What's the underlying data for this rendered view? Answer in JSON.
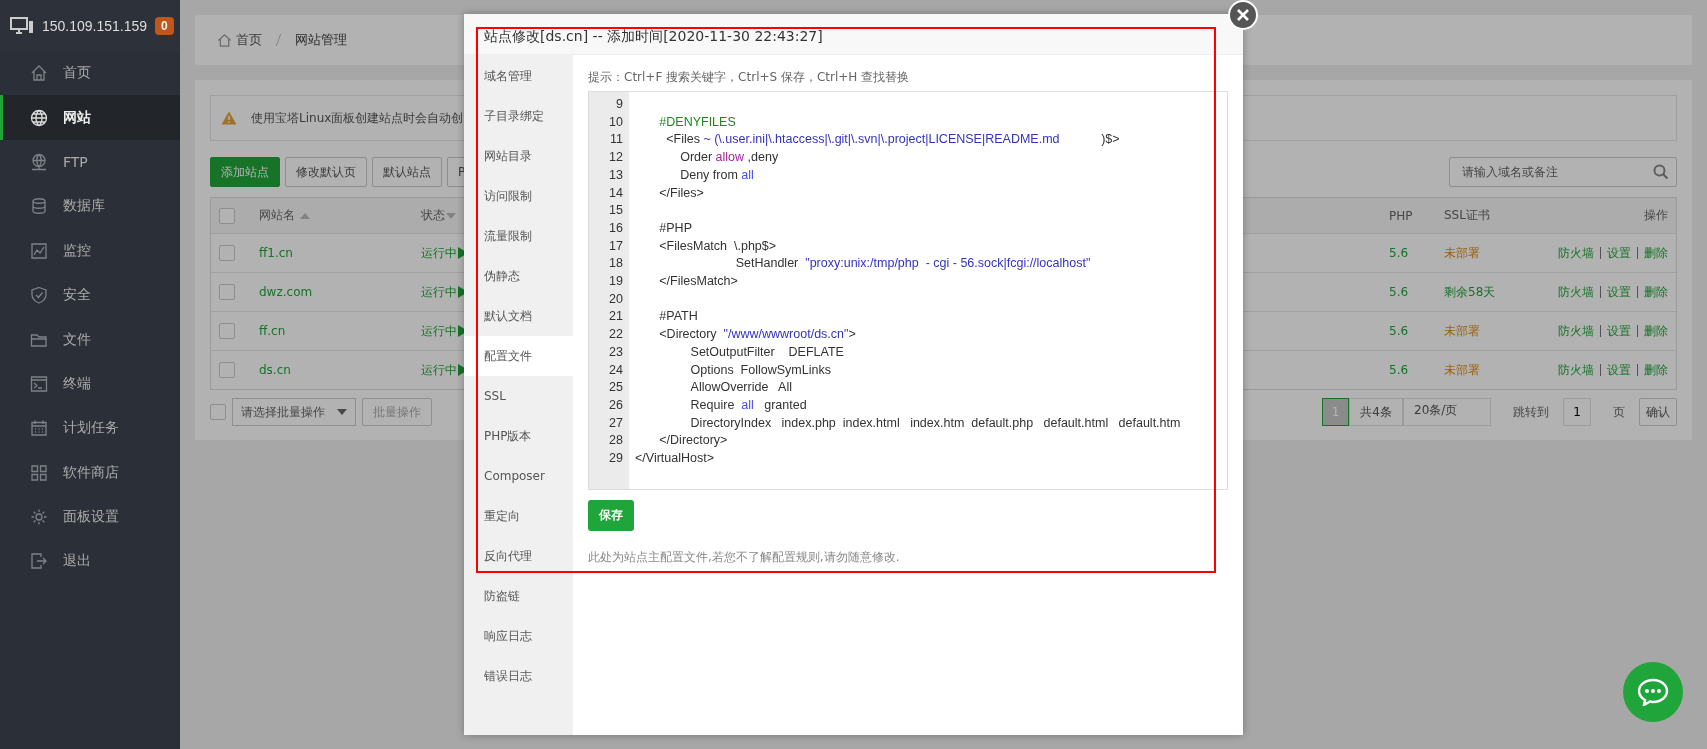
{
  "sidebar": {
    "server": "150.109.151.159",
    "badge": "0",
    "items": [
      {
        "label": "首页",
        "selected": false
      },
      {
        "label": "网站",
        "selected": true
      },
      {
        "label": "FTP",
        "selected": false
      },
      {
        "label": "数据库",
        "selected": false
      },
      {
        "label": "监控",
        "selected": false
      },
      {
        "label": "安全",
        "selected": false
      },
      {
        "label": "文件",
        "selected": false
      },
      {
        "label": "终端",
        "selected": false
      },
      {
        "label": "计划任务",
        "selected": false
      },
      {
        "label": "软件商店",
        "selected": false
      },
      {
        "label": "面板设置",
        "selected": false
      },
      {
        "label": "退出",
        "selected": false
      }
    ]
  },
  "breadcrumb": [
    "首页",
    "网站管理"
  ],
  "notice": "使用宝塔Linux面板创建站点时会自动创",
  "toolbar": {
    "buttons": [
      {
        "label": "添加站点",
        "primary": true
      },
      {
        "label": "修改默认页",
        "primary": false
      },
      {
        "label": "默认站点",
        "primary": false
      },
      {
        "label": "P",
        "primary": false
      }
    ],
    "search": {
      "placeholder": "请输入域名或备注"
    }
  },
  "table": {
    "columns": [
      {
        "label": "网站名",
        "kind": "sort-up"
      },
      {
        "label": "状态",
        "kind": "sort-down"
      },
      {
        "label": "PHP",
        "kind": "plain"
      },
      {
        "label": "SSL证书",
        "kind": "plain"
      },
      {
        "label": "操作",
        "kind": "plain"
      }
    ],
    "all_checked": false,
    "rows": [
      {
        "checked": false,
        "name": "ff1.cn",
        "status": "运行中",
        "php": "5.6",
        "ssl": "未部署",
        "deployed": false,
        "actions": [
          "防火墙",
          "设置",
          "删除"
        ]
      },
      {
        "checked": false,
        "name": "dwz.com",
        "status": "运行中",
        "php": "5.6",
        "ssl": "剩余58天",
        "deployed": true,
        "actions": [
          "防火墙",
          "设置",
          "删除"
        ]
      },
      {
        "checked": false,
        "name": "ff.cn",
        "status": "运行中",
        "php": "5.6",
        "ssl": "未部署",
        "deployed": false,
        "actions": [
          "防火墙",
          "设置",
          "删除"
        ]
      },
      {
        "checked": false,
        "name": "ds.cn",
        "status": "运行中",
        "php": "5.6",
        "ssl": "未部署",
        "deployed": false,
        "actions": [
          "防火墙",
          "设置",
          "删除"
        ]
      }
    ]
  },
  "footer": {
    "checked": false,
    "batch_select": "请选择批量操作",
    "batch_button": "批量操作",
    "pages": [
      {
        "label": "1",
        "selected": true
      }
    ],
    "total": "共4条",
    "page_size": "20条/页",
    "jump_label": "跳转到",
    "jump_value": "1",
    "page_unit": "页",
    "confirm": "确认"
  },
  "modal": {
    "title": "站点修改[ds.cn] -- 添加时间[2020-11-30 22:43:27]",
    "tabs": [
      {
        "label": "域名管理",
        "selected": false
      },
      {
        "label": "子目录绑定",
        "selected": false
      },
      {
        "label": "网站目录",
        "selected": false
      },
      {
        "label": "访问限制",
        "selected": false
      },
      {
        "label": "流量限制",
        "selected": false
      },
      {
        "label": "伪静态",
        "selected": false
      },
      {
        "label": "默认文档",
        "selected": false
      },
      {
        "label": "配置文件",
        "selected": true
      },
      {
        "label": "SSL",
        "selected": false
      },
      {
        "label": "PHP版本",
        "selected": false
      },
      {
        "label": "Composer",
        "selected": false
      },
      {
        "label": "重定向",
        "selected": false
      },
      {
        "label": "反向代理",
        "selected": false
      },
      {
        "label": "防盗链",
        "selected": false
      },
      {
        "label": "响应日志",
        "selected": false
      },
      {
        "label": "错误日志",
        "selected": false
      }
    ],
    "hint": "提示：Ctrl+F 搜索关键字，Ctrl+S 保存，Ctrl+H 查找替换",
    "code": [
      {
        "num": "9"
      },
      {
        "num": "10",
        "tokens": [
          {
            "text": "       #DENYFILES",
            "kind": "comment"
          }
        ]
      },
      {
        "num": "11",
        "tokens": [
          {
            "text": "         <Files ",
            "kind": "plain"
          },
          {
            "text": "~ (\\.user.ini|\\.htaccess|\\.git|\\.svn|\\.project|LICENSE|README.md",
            "kind": "string"
          },
          {
            "text": "            )$>",
            "kind": "plain"
          }
        ]
      },
      {
        "num": "12",
        "tokens": [
          {
            "text": "             Order ",
            "kind": "plain"
          },
          {
            "text": "allow",
            "kind": "keyword"
          },
          {
            "text": " ,deny",
            "kind": "plain"
          }
        ]
      },
      {
        "num": "13",
        "tokens": [
          {
            "text": "             Deny from ",
            "kind": "plain"
          },
          {
            "text": "all",
            "kind": "atom"
          }
        ]
      },
      {
        "num": "14",
        "tokens": [
          {
            "text": "       </Files>",
            "kind": "plain"
          }
        ]
      },
      {
        "num": "15"
      },
      {
        "num": "16",
        "tokens": [
          {
            "text": "       #PHP",
            "kind": "plain"
          }
        ]
      },
      {
        "num": "17",
        "tokens": [
          {
            "text": "       <FilesMatch  \\.php$>",
            "kind": "plain"
          }
        ]
      },
      {
        "num": "18",
        "tokens": [
          {
            "text": "                             SetHandler  ",
            "kind": "plain"
          },
          {
            "text": "\"proxy:unix:/tmp/php  - cgi - 56.sock|fcgi://localhost\"",
            "kind": "string"
          }
        ]
      },
      {
        "num": "19",
        "tokens": [
          {
            "text": "       </FilesMatch>",
            "kind": "plain"
          }
        ]
      },
      {
        "num": "20"
      },
      {
        "num": "21",
        "tokens": [
          {
            "text": "       #PATH",
            "kind": "plain"
          }
        ]
      },
      {
        "num": "22",
        "tokens": [
          {
            "text": "       <Directory  ",
            "kind": "plain"
          },
          {
            "text": "\"/www/wwwroot/ds.cn\"",
            "kind": "string"
          },
          {
            "text": ">",
            "kind": "plain"
          }
        ]
      },
      {
        "num": "23",
        "tokens": [
          {
            "text": "                SetOutputFilter    DEFLATE",
            "kind": "plain"
          }
        ]
      },
      {
        "num": "24",
        "tokens": [
          {
            "text": "                Options  FollowSymLinks",
            "kind": "plain"
          }
        ]
      },
      {
        "num": "25",
        "tokens": [
          {
            "text": "                AllowOverride   All",
            "kind": "plain"
          }
        ]
      },
      {
        "num": "26",
        "tokens": [
          {
            "text": "                Require  ",
            "kind": "plain"
          },
          {
            "text": "all",
            "kind": "atom"
          },
          {
            "text": "   granted",
            "kind": "plain"
          }
        ]
      },
      {
        "num": "27",
        "tokens": [
          {
            "text": "                DirectoryIndex   index.php  index.html   index.htm  default.php   default.html   default.htm",
            "kind": "plain"
          }
        ]
      },
      {
        "num": "28",
        "tokens": [
          {
            "text": "       </Directory>",
            "kind": "plain"
          }
        ]
      },
      {
        "num": "29",
        "tokens": [
          {
            "text": "</VirtualHost>",
            "kind": "plain"
          }
        ]
      }
    ],
    "save": "保存",
    "note": "此处为站点主配置文件,若您不了解配置规则,请勿随意修改."
  }
}
